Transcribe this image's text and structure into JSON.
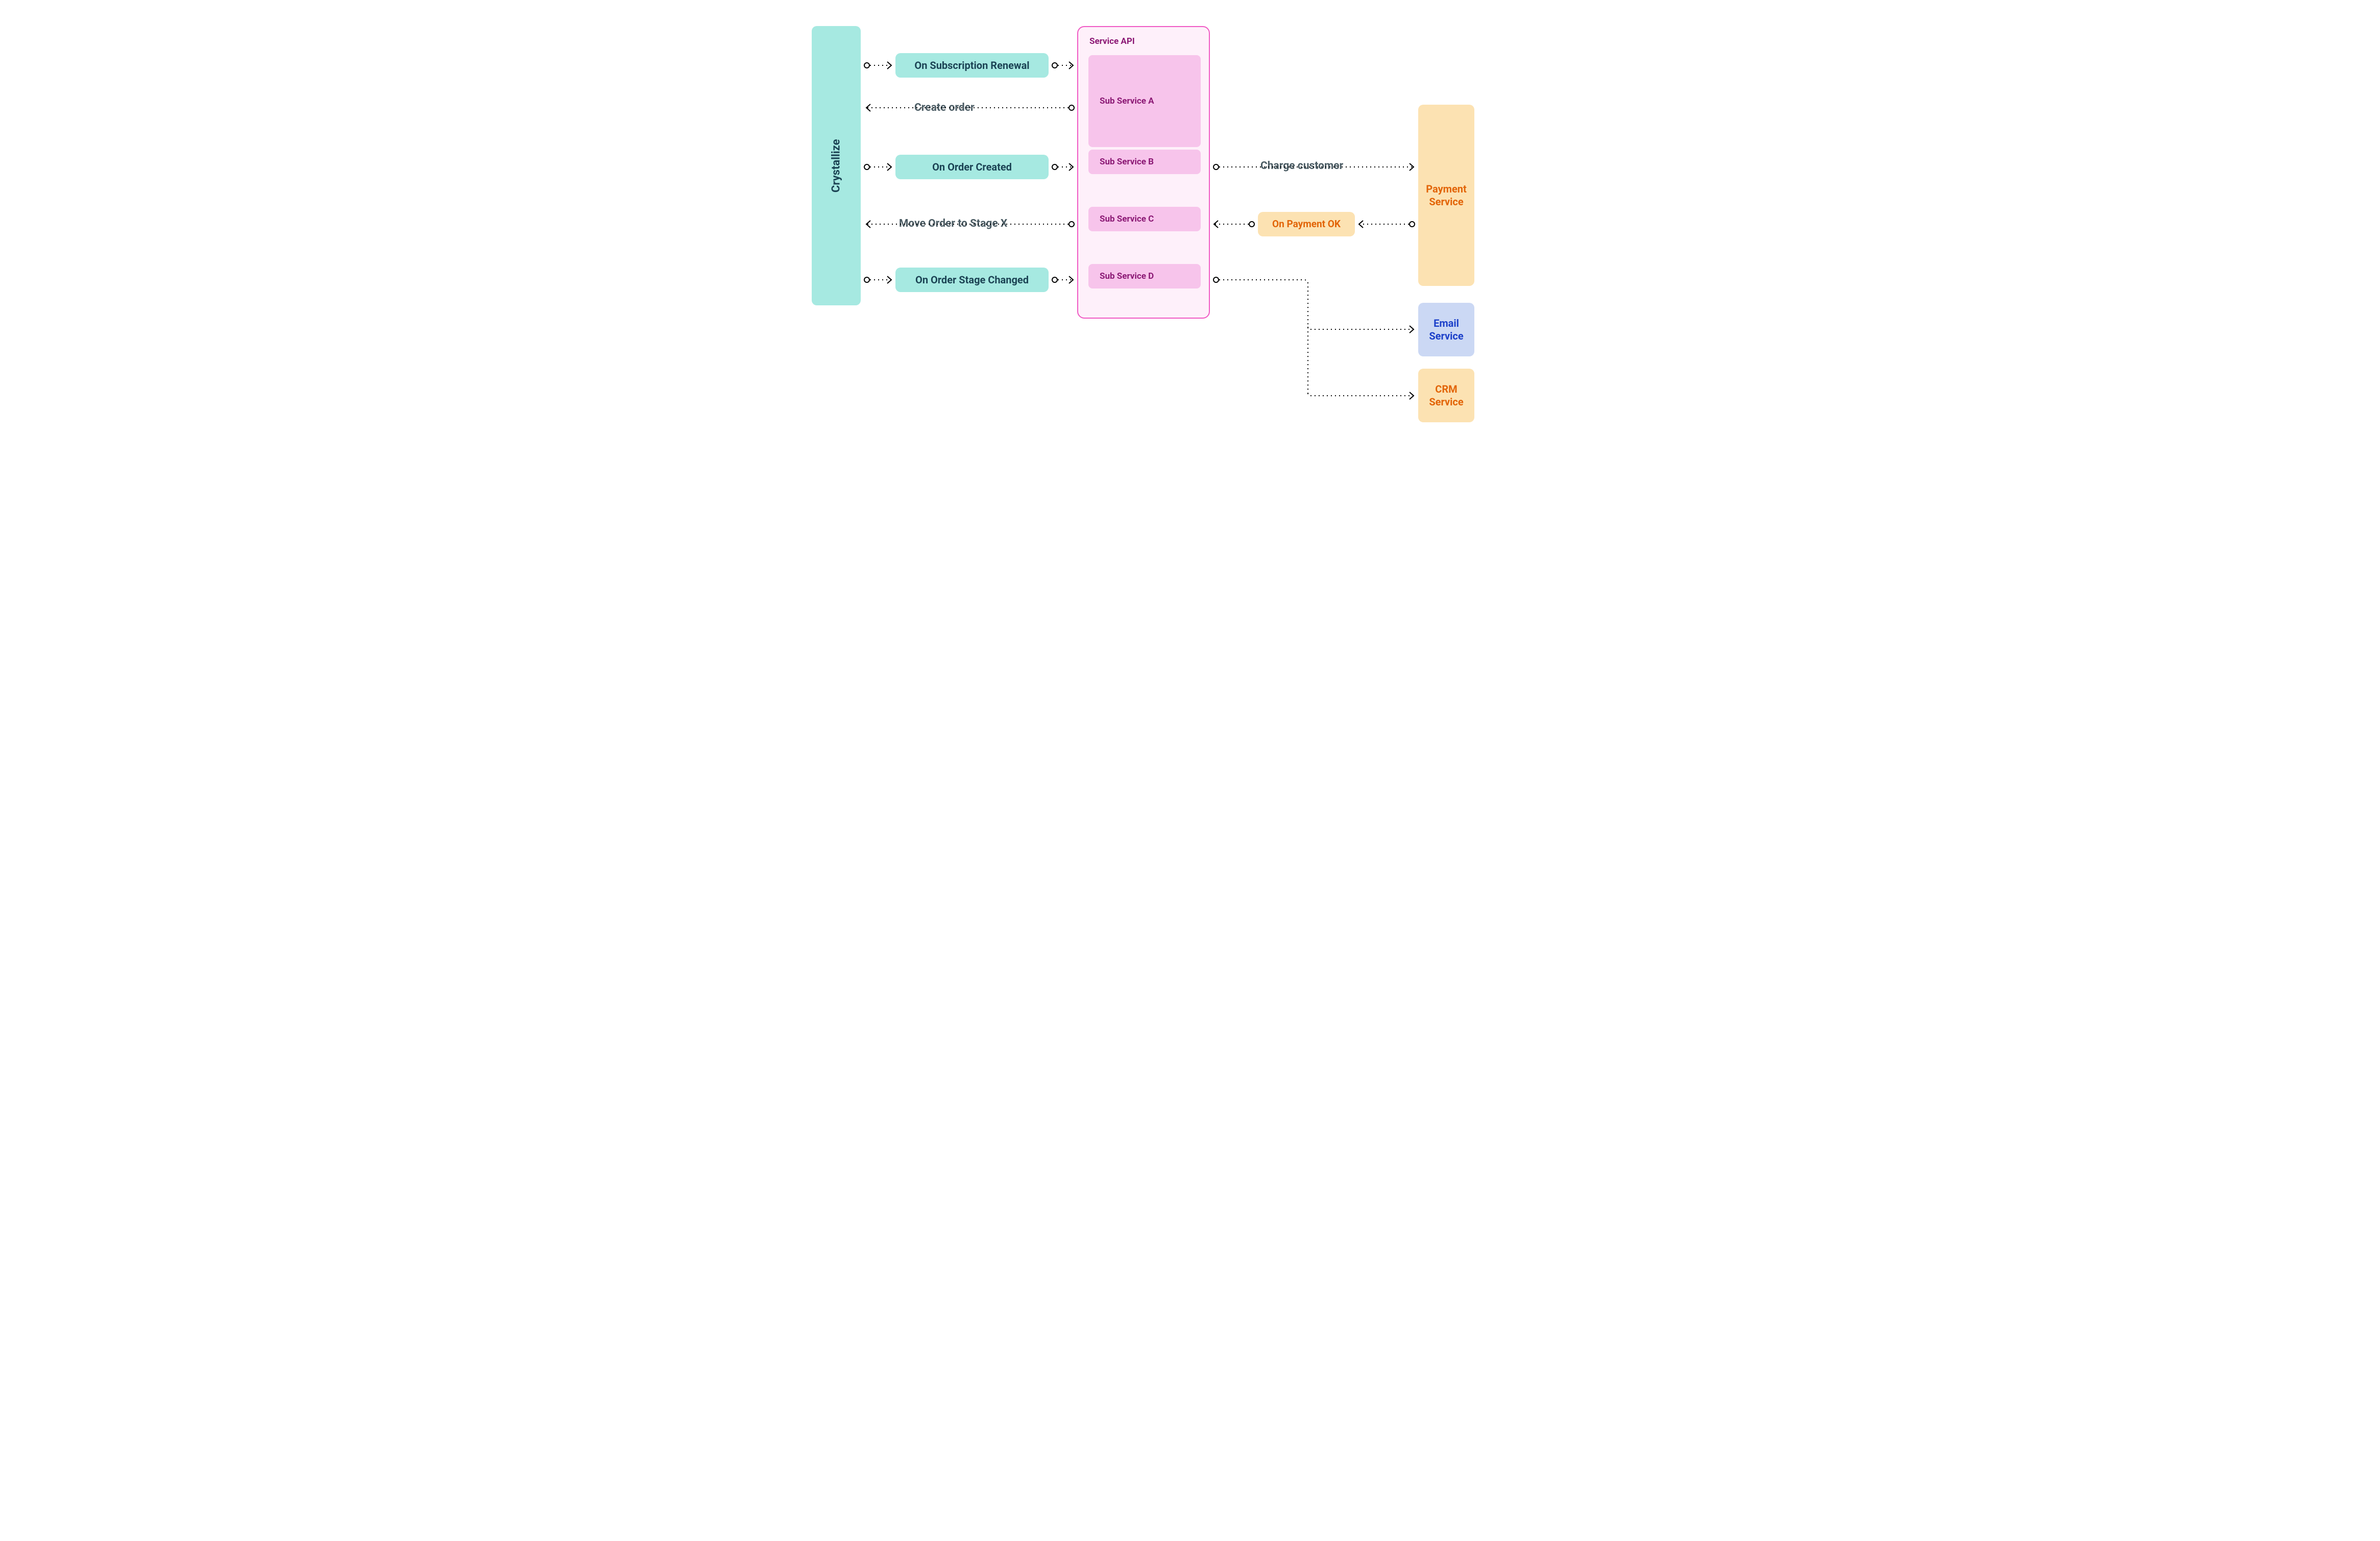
{
  "crystallize": {
    "label": "Crystallize"
  },
  "events": {
    "renewal": "On Subscription Renewal",
    "orderCreated": "On Order Created",
    "stageChanged": "On Order Stage Changed"
  },
  "serviceApi": {
    "title": "Service API",
    "subA": "Sub Service A",
    "subB": "Sub Service B",
    "subC": "Sub Service C",
    "subD": "Sub Service D"
  },
  "actions": {
    "createOrder": "Create order",
    "moveOrder": "Move Order to Stage X",
    "charge": "Charge customer",
    "onPaymentOk": "On Payment OK"
  },
  "services": {
    "payment": "Payment Service",
    "email": "Email Service",
    "crm": "CRM Service"
  },
  "colors": {
    "teal": "#A6E9E1",
    "tealText": "#1b4354",
    "pinkPanelBg": "#FEF0FA",
    "pinkPanelBorder": "#F05AC4",
    "pinkSubBg": "#F7C4EB",
    "pinkText": "#8B1874",
    "orangeBg": "#FCE2B2",
    "orangeText": "#E26407",
    "blueBg": "#CBD8F4",
    "blueText": "#1B3FC9",
    "labelText": "#4a5b63"
  }
}
